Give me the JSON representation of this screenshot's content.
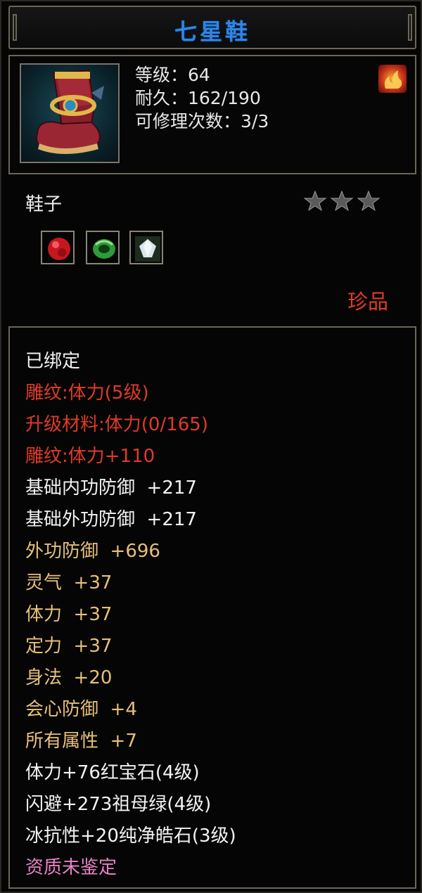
{
  "item": {
    "name": "七星鞋",
    "level_line": "等级：64",
    "durability_line": "耐久：162/190",
    "repairs_line": "可修理次数：3/3",
    "type": "鞋子",
    "rarity": "珍品",
    "stars_filled": 0,
    "stars_total": 3,
    "gems": [
      {
        "name": "红宝石",
        "icon": "ruby-gem-icon",
        "color": "#c8161e"
      },
      {
        "name": "祖母绿",
        "icon": "emerald-gem-icon",
        "color": "#2e9a3a"
      },
      {
        "name": "纯净皓石",
        "icon": "diamond-gem-icon",
        "color": "#d8e6ee"
      }
    ]
  },
  "attributes": [
    {
      "text": "已绑定",
      "color": "white"
    },
    {
      "text": "雕纹:体力(5级)",
      "color": "red"
    },
    {
      "text": "升级材料:体力(0/165)",
      "color": "red"
    },
    {
      "text": "雕纹:体力+110",
      "color": "red"
    },
    {
      "text": "基础内功防御  +217",
      "color": "white"
    },
    {
      "text": "基础外功防御  +217",
      "color": "white"
    },
    {
      "text": "外功防御  +696",
      "color": "gold"
    },
    {
      "text": "灵气  +37",
      "color": "gold"
    },
    {
      "text": "体力  +37",
      "color": "gold"
    },
    {
      "text": "定力  +37",
      "color": "gold"
    },
    {
      "text": "身法  +20",
      "color": "gold"
    },
    {
      "text": "会心防御  +4",
      "color": "gold"
    },
    {
      "text": "所有属性  +7",
      "color": "gold"
    },
    {
      "text": "体力+76红宝石(4级)",
      "color": "white"
    },
    {
      "text": "闪避+273祖母绿(4级)",
      "color": "white"
    },
    {
      "text": "冰抗性+20纯净皓石(3级)",
      "color": "white"
    },
    {
      "text": "资质未鉴定",
      "color": "pink"
    }
  ],
  "colors": {
    "title": "#2f86e6",
    "white": "#f2f2f2",
    "red": "#e03a28",
    "gold": "#e6c079",
    "pink": "#e882c4",
    "border": "#6c6656"
  }
}
